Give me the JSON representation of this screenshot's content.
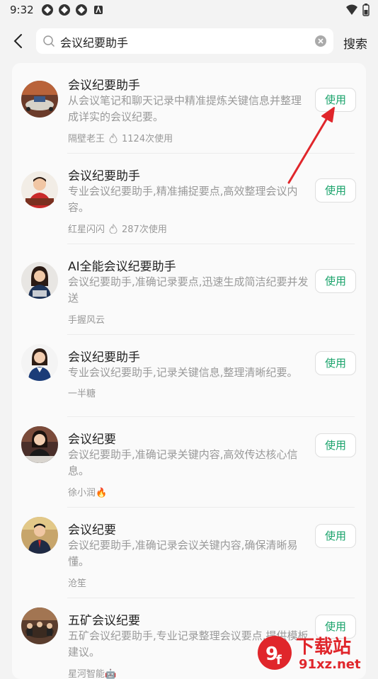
{
  "status": {
    "time": "9:32"
  },
  "search": {
    "query": "会议纪要助手",
    "submit_label": "搜索"
  },
  "items": [
    {
      "title": "会议纪要助手",
      "desc": "从会议笔记和聊天记录中精准提炼关键信息并整理成详实的会议纪要。",
      "author": "隔壁老王",
      "uses": "1124次使用",
      "button": "使用"
    },
    {
      "title": "会议纪要助手",
      "desc": "专业会议纪要助手,精准捕捉要点,高效整理会议内容。",
      "author": "红星闪闪",
      "uses": "287次使用",
      "button": "使用"
    },
    {
      "title": "AI全能会议纪要助手",
      "desc": "会议纪要助手,准确记录要点,迅速生成简洁纪要并发送",
      "author": "手握风云",
      "uses": "",
      "button": "使用"
    },
    {
      "title": "会议纪要助手",
      "desc": "专业会议纪要助手,记录关键信息,整理清晰纪要。",
      "author": "一半糖",
      "uses": "",
      "button": "使用"
    },
    {
      "title": "会议纪要",
      "desc": "会议纪要助手,准确记录关键内容,高效传达核心信息。",
      "author": "徐小润🔥",
      "uses": "",
      "button": "使用"
    },
    {
      "title": "会议纪要",
      "desc": "会议纪要助手,准确记录会议关键内容,确保清晰易懂。",
      "author": "沧笙",
      "uses": "",
      "button": "使用"
    },
    {
      "title": "五矿会议纪要",
      "desc": "五矿会议纪要助手,专业记录整理会议要点,提供模板建议。",
      "author": "星河智能🤖",
      "uses": "",
      "button": "使用"
    }
  ],
  "watermark": {
    "text": "下载站",
    "url_text": "91xz.net"
  },
  "colors": {
    "accent": "#1aa36b",
    "arrow": "#e0262b"
  }
}
